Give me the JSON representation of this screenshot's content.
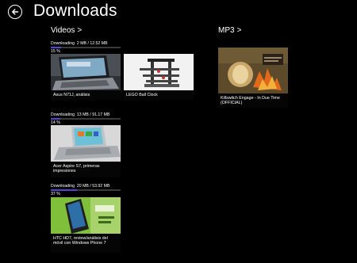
{
  "header": {
    "title": "Downloads"
  },
  "groups": {
    "videos": {
      "label": "Videos",
      "chevron": ">"
    },
    "mp3": {
      "label": "MP3",
      "chevron": ">"
    }
  },
  "downloads": [
    {
      "status": "Downloading",
      "size": "2 MB / 12.52 MB",
      "percent_text": "15 %",
      "progress": 0.15,
      "title": "Asus N71J, análisis"
    },
    {
      "status": "Downloading",
      "size": "13 MB / 91.17 MB",
      "percent_text": "14 %",
      "progress": 0.14,
      "title": "Acer Aspire S7, primeras impresiones"
    },
    {
      "status": "Downloading",
      "size": "20 MB / 53.92 MB",
      "percent_text": "37 %",
      "progress": 0.37,
      "title": "HTC HD7, review/análisis del móvil con Windows Phone 7"
    }
  ],
  "videos_complete": [
    {
      "title": "LEGO Ball Clock"
    }
  ],
  "mp3_items": [
    {
      "title": "Killswitch Engage - In Due Time (OFFICIAL)"
    }
  ],
  "colors": {
    "progress_fill": "#5a3fd9",
    "background": "#000000"
  },
  "icons": {
    "back": "back-arrow-icon"
  }
}
